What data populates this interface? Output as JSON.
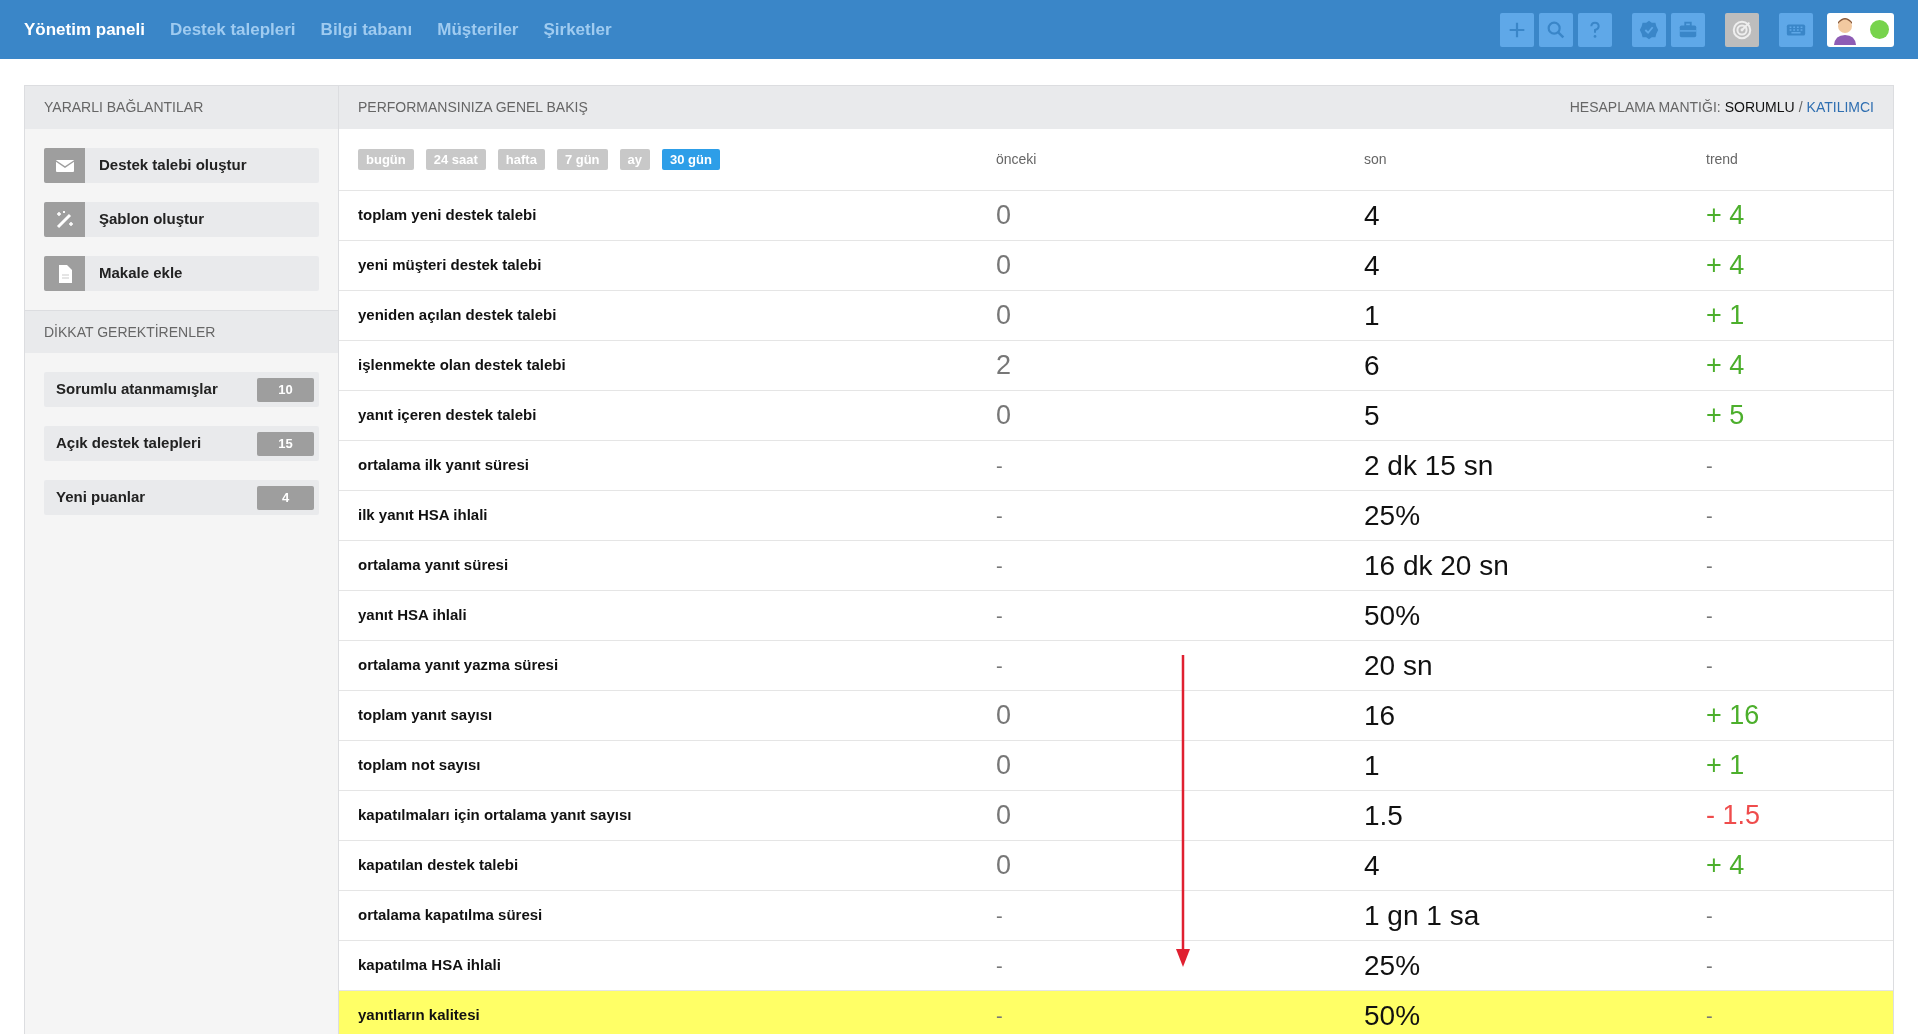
{
  "nav": [
    {
      "label": "Yönetim paneli",
      "selected": true
    },
    {
      "label": "Destek talepleri",
      "selected": false
    },
    {
      "label": "Bilgi tabanı",
      "selected": false
    },
    {
      "label": "Müşteriler",
      "selected": false
    },
    {
      "label": "Şirketler",
      "selected": false
    }
  ],
  "toolbar": [
    {
      "kind": "plus",
      "selected": false
    },
    {
      "kind": "search",
      "selected": false
    },
    {
      "kind": "help",
      "selected": false
    },
    {
      "kind": "gap"
    },
    {
      "kind": "badge",
      "selected": false
    },
    {
      "kind": "briefcase",
      "selected": false
    },
    {
      "kind": "gap"
    },
    {
      "kind": "target",
      "selected": true
    },
    {
      "kind": "gap"
    },
    {
      "kind": "keyboard",
      "selected": false
    }
  ],
  "user": {
    "online": true
  },
  "sidebar": {
    "links_title": "YARARLI BAĞLANTILAR",
    "links": [
      {
        "kind": "mail",
        "label": "Destek talebi oluştur"
      },
      {
        "kind": "wand",
        "label": "Şablon oluştur"
      },
      {
        "kind": "file",
        "label": "Makale ekle"
      }
    ],
    "attention_title": "DİKKAT GEREKTİRENLER",
    "attention": [
      {
        "label": "Sorumlu atanmamışlar",
        "count": "10"
      },
      {
        "label": "Açık destek talepleri",
        "count": "15"
      },
      {
        "label": "Yeni puanlar",
        "count": "4"
      }
    ]
  },
  "overview": {
    "title": "PERFORMANSINIZA GENEL BAKIŞ",
    "logic_label": "HESAPLAMA MANTIĞI:",
    "logic_options": [
      {
        "label": "SORUMLU",
        "selected": true
      },
      {
        "label": "KATILIMCI",
        "selected": false
      }
    ],
    "logic_separator": "/",
    "periods": [
      {
        "label": "bugün",
        "selected": false
      },
      {
        "label": "24 saat",
        "selected": false
      },
      {
        "label": "hafta",
        "selected": false
      },
      {
        "label": "7 gün",
        "selected": false
      },
      {
        "label": "ay",
        "selected": false
      },
      {
        "label": "30 gün",
        "selected": true
      }
    ],
    "columns": [
      "önceki",
      "son",
      "trend"
    ],
    "rows": [
      {
        "kind": "up",
        "label": "toplam yeni destek talebi",
        "previous": "0",
        "current": "4",
        "trend": "+ 4",
        "highlighted": false
      },
      {
        "kind": "up",
        "label": "yeni müşteri destek talebi",
        "previous": "0",
        "current": "4",
        "trend": "+ 4",
        "highlighted": false
      },
      {
        "kind": "up",
        "label": "yeniden açılan destek talebi",
        "previous": "0",
        "current": "1",
        "trend": "+ 1",
        "highlighted": false
      },
      {
        "kind": "up",
        "label": "işlenmekte olan destek talebi",
        "previous": "2",
        "current": "6",
        "trend": "+ 4",
        "highlighted": false
      },
      {
        "kind": "up",
        "label": "yanıt içeren destek talebi",
        "previous": "0",
        "current": "5",
        "trend": "+ 5",
        "highlighted": false
      },
      {
        "kind": "none",
        "label": "ortalama ilk yanıt süresi",
        "previous": "-",
        "current": "2 dk 15 sn",
        "trend": "-",
        "highlighted": false
      },
      {
        "kind": "none",
        "label": "ilk yanıt HSA ihlali",
        "previous": "-",
        "current": "25%",
        "trend": "-",
        "highlighted": false
      },
      {
        "kind": "none",
        "label": "ortalama yanıt süresi",
        "previous": "-",
        "current": "16 dk 20 sn",
        "trend": "-",
        "highlighted": false
      },
      {
        "kind": "none",
        "label": "yanıt HSA ihlali",
        "previous": "-",
        "current": "50%",
        "trend": "-",
        "highlighted": false
      },
      {
        "kind": "none",
        "label": "ortalama yanıt yazma süresi",
        "previous": "-",
        "current": "20 sn",
        "trend": "-",
        "highlighted": false
      },
      {
        "kind": "up",
        "label": "toplam yanıt sayısı",
        "previous": "0",
        "current": "16",
        "trend": "+ 16",
        "highlighted": false
      },
      {
        "kind": "up",
        "label": "toplam not sayısı",
        "previous": "0",
        "current": "1",
        "trend": "+ 1",
        "highlighted": false
      },
      {
        "kind": "down",
        "label": "kapatılmaları için ortalama yanıt sayısı",
        "previous": "0",
        "current": "1.5",
        "trend": "- 1.5",
        "highlighted": false
      },
      {
        "kind": "up",
        "label": "kapatılan destek talebi",
        "previous": "0",
        "current": "4",
        "trend": "+ 4",
        "highlighted": false
      },
      {
        "kind": "none",
        "label": "ortalama kapatılma süresi",
        "previous": "-",
        "current": "1 gn 1 sa",
        "trend": "-",
        "highlighted": false
      },
      {
        "kind": "none",
        "label": "kapatılma HSA ihlali",
        "previous": "-",
        "current": "25%",
        "trend": "-",
        "highlighted": false
      },
      {
        "kind": "none",
        "label": "yanıtların kalitesi",
        "previous": "-",
        "current": "50%",
        "trend": "-",
        "highlighted": true
      }
    ]
  }
}
